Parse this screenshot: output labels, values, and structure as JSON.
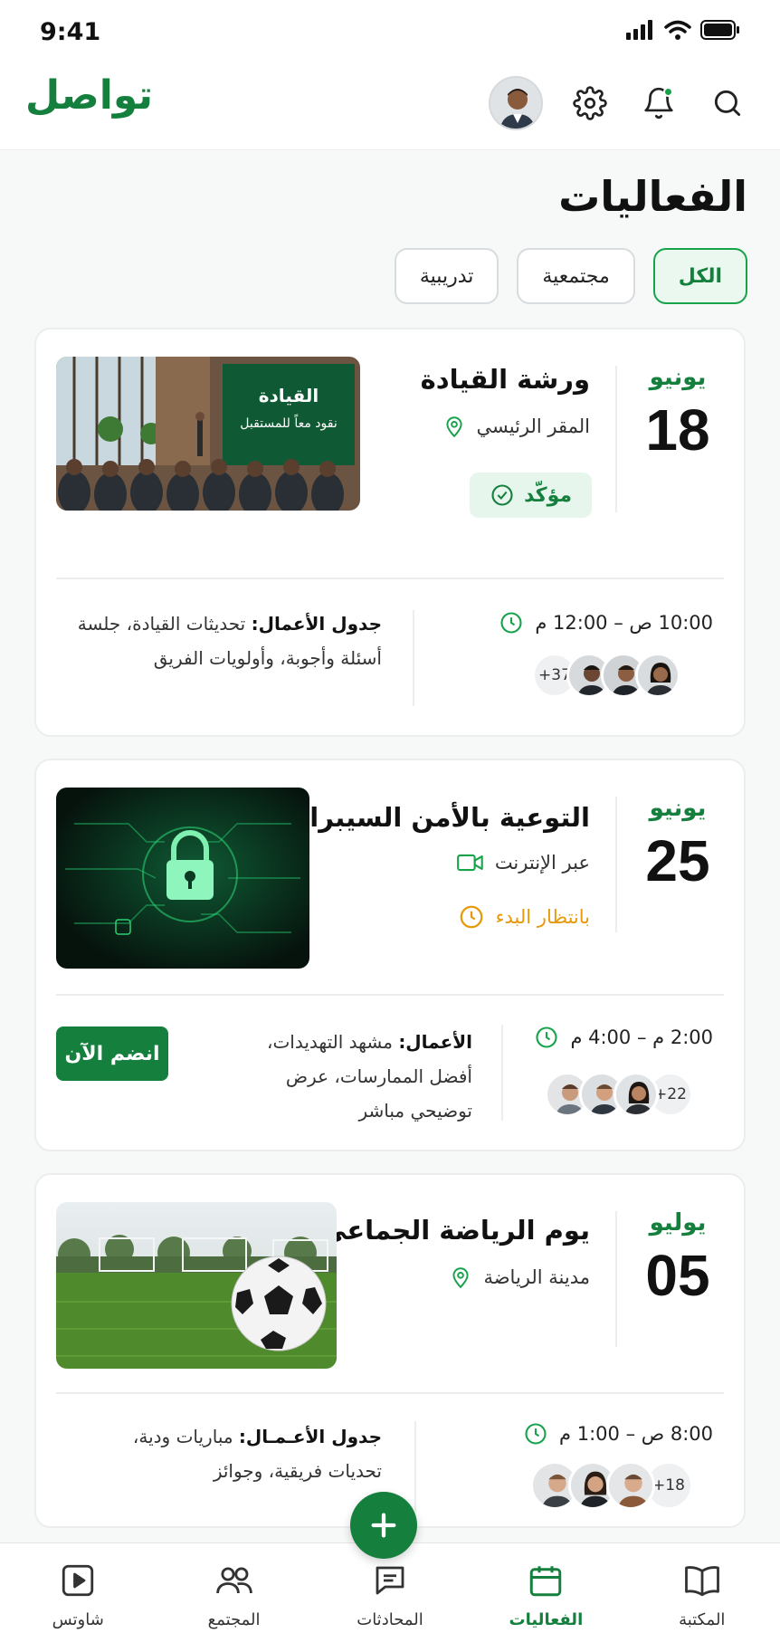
{
  "status_bar": {
    "time": "9:41"
  },
  "app": {
    "brand": "تواصل",
    "accent": "#15803d"
  },
  "page": {
    "title": "الفعاليات"
  },
  "filters": [
    {
      "label": "الكل",
      "active": true
    },
    {
      "label": "مجتمعية",
      "active": false
    },
    {
      "label": "تدريبية",
      "active": false
    }
  ],
  "events": [
    {
      "month": "يونيو",
      "day": "18",
      "title": "ورشة القيادة",
      "location": "المقر الرئيسي",
      "location_icon": "location-pin-icon",
      "status": "مؤكّد",
      "image_text": {
        "line1": "القيادة",
        "line2": "نقود معاً للمستقبل"
      },
      "time": "10:00 ص – 12:00 م",
      "agenda_label": "جدول الأعمال:",
      "agenda_text": "تحديثات القيادة، جلسة أسئلة وأجوبة، وأولويات الفريق",
      "more_count": "+37"
    },
    {
      "month": "يونيو",
      "day": "25",
      "title": "التوعية بالأمن السيبراني",
      "location": "عبر الإنترنت",
      "location_icon": "video-camera-icon",
      "status": "بانتظار البدء",
      "time": "2:00 م – 4:00 م",
      "agenda_label": "الأعمال:",
      "agenda_text": "مشهد التهديدات، أفضل الممارسات، عرض توضيحي مباشر",
      "join_label": "انضم الآن",
      "more_count": "+22"
    },
    {
      "month": "يوليو",
      "day": "05",
      "title": "يوم الرياضة الجماعي",
      "location": "مدينة الرياضة",
      "location_icon": "location-pin-icon",
      "time": "8:00 ص – 1:00 م",
      "agenda_label": "جدول الأعـمـال:",
      "agenda_text": "مباريات ودية، تحديات فريقية، وجوائز",
      "more_count": "+18"
    }
  ],
  "tabbar": [
    {
      "label": "المكتبة",
      "icon": "book-icon",
      "active": false
    },
    {
      "label": "الفعاليات",
      "icon": "calendar-icon",
      "active": true
    },
    {
      "label": "المحادثات",
      "icon": "chat-icon",
      "active": false
    },
    {
      "label": "المجتمع",
      "icon": "people-icon",
      "active": false
    },
    {
      "label": "شاوتس",
      "icon": "play-icon",
      "active": false
    }
  ]
}
